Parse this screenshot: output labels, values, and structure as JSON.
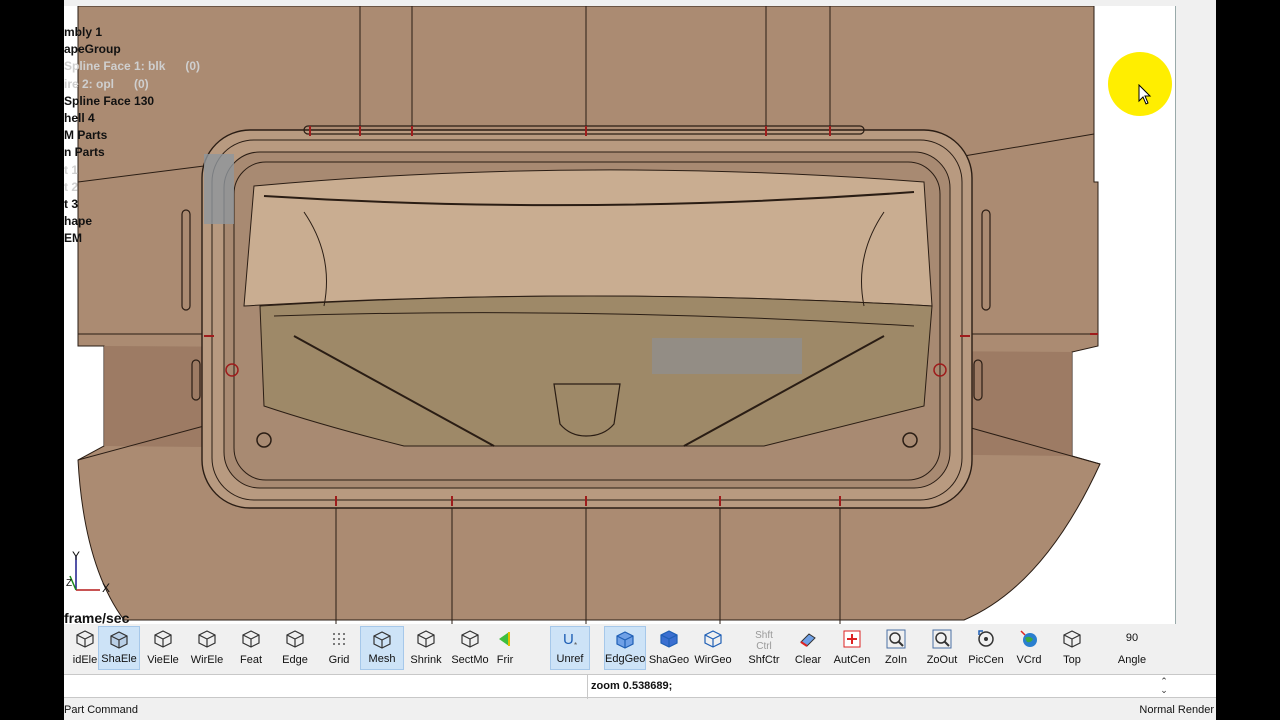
{
  "tree": [
    {
      "text": "mbly 1",
      "dim": false
    },
    {
      "text": "apeGroup",
      "dim": false
    },
    {
      "text": "Spline Face 1: blk",
      "count": "(0)",
      "dim": true
    },
    {
      "text": "ire 2: opl",
      "count": "(0)",
      "dim": true
    },
    {
      "text": "Spline Face 130",
      "dim": false
    },
    {
      "text": "hell 4",
      "dim": false
    },
    {
      "text": "M Parts",
      "dim": false
    },
    {
      "text": "n Parts",
      "dim": false
    },
    {
      "text": "t 1",
      "dim": true
    },
    {
      "text": "t 2",
      "dim": true
    },
    {
      "text": "t 3",
      "dim": false
    },
    {
      "text": "hape",
      "dim": false
    },
    {
      "text": "EM",
      "dim": false
    }
  ],
  "overlay": {
    "fps_label": "frame/sec",
    "axis_y": "Y",
    "axis_x": "X",
    "axis_z": "Z"
  },
  "toolbar": {
    "buttons": [
      {
        "id": "solid-element",
        "label": "idEle",
        "icon": "cube-mesh-icon",
        "active": false
      },
      {
        "id": "shade-element",
        "label": "ShaEle",
        "icon": "shaded-cube-icon",
        "active": true
      },
      {
        "id": "view-element",
        "label": "VieEle",
        "icon": "view-cube-icon",
        "active": false
      },
      {
        "id": "wire-element",
        "label": "WirEle",
        "icon": "wire-cube-icon",
        "active": false
      },
      {
        "id": "feature",
        "label": "Feat",
        "icon": "feature-cube-icon",
        "active": false
      },
      {
        "id": "edge",
        "label": "Edge",
        "icon": "edge-cube-icon",
        "active": false
      },
      {
        "id": "grid",
        "label": "Grid",
        "icon": "grid-dots-icon",
        "active": false
      },
      {
        "id": "mesh",
        "label": "Mesh",
        "icon": "mesh-cube-icon",
        "active": true
      },
      {
        "id": "shrink",
        "label": "Shrink",
        "icon": "shrink-cube-icon",
        "active": false
      },
      {
        "id": "section-mode",
        "label": "SectMo",
        "icon": "section-cube-icon",
        "active": false
      },
      {
        "id": "fringe",
        "label": "Frir",
        "icon": "fringe-icon",
        "active": false
      },
      {
        "id": "unref",
        "label": "Unref",
        "icon": "u-symbol-icon",
        "active": true
      },
      {
        "id": "edge-geometry",
        "label": "EdgGeo",
        "icon": "blue-edge-cube-icon",
        "active": true
      },
      {
        "id": "shade-geometry",
        "label": "ShaGeo",
        "icon": "blue-solid-cube-icon",
        "active": false
      },
      {
        "id": "wire-geometry",
        "label": "WirGeo",
        "icon": "blue-wire-cube-icon",
        "active": false
      },
      {
        "id": "shift-center",
        "label": "ShfCtr",
        "icon": "shift-ctrl-icon",
        "active": false
      },
      {
        "id": "clear",
        "label": "Clear",
        "icon": "eraser-icon",
        "active": false
      },
      {
        "id": "auto-center",
        "label": "AutCen",
        "icon": "auto-center-icon",
        "active": false
      },
      {
        "id": "zoom-in",
        "label": "ZoIn",
        "icon": "zoom-in-icon",
        "active": false
      },
      {
        "id": "zoom-out",
        "label": "ZoOut",
        "icon": "zoom-out-icon",
        "active": false
      },
      {
        "id": "pick-center",
        "label": "PicCen",
        "icon": "pick-center-icon",
        "active": false
      },
      {
        "id": "view-coord",
        "label": "VCrd",
        "icon": "globe-icon",
        "active": false
      },
      {
        "id": "top-view",
        "label": "Top",
        "icon": "top-view-cube-icon",
        "active": false
      },
      {
        "id": "angle",
        "label": "Angle",
        "icon": "angle-value",
        "active": false
      }
    ],
    "shift_ctrl_text": [
      "Shft",
      "Ctrl"
    ],
    "angle_value": "90"
  },
  "command": {
    "text": "zoom 0.538689;",
    "spin_up": "⌃",
    "spin_down": "⌄"
  },
  "status": {
    "left": "Part Command",
    "right": "Normal Render"
  },
  "colors": {
    "model_fill": "#ab8b72",
    "model_dark": "#8e6d57",
    "edge_line": "#2a1d14",
    "mesh_marks": "#9e1c1c",
    "accent": "#2a6fbf",
    "cursor_highlight": "#ffee00"
  }
}
